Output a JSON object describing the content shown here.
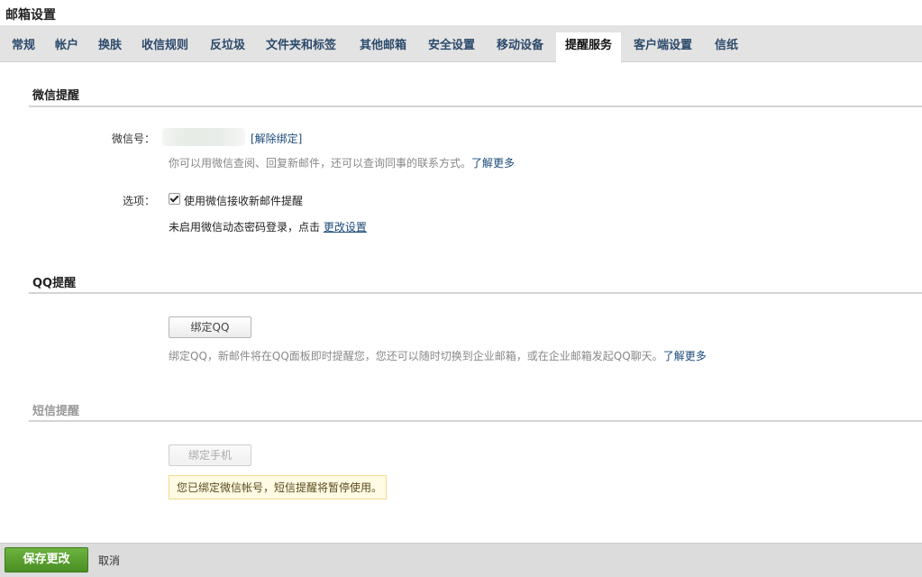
{
  "page_title": "邮箱设置",
  "tabs": [
    {
      "label": "常规"
    },
    {
      "label": "帐户"
    },
    {
      "label": "换肤"
    },
    {
      "label": "收信规则"
    },
    {
      "label": "反垃圾"
    },
    {
      "label": "文件夹和标签"
    },
    {
      "label": "其他邮箱"
    },
    {
      "label": "安全设置"
    },
    {
      "label": "移动设备"
    },
    {
      "label": "提醒服务",
      "active": true
    },
    {
      "label": "客户端设置"
    },
    {
      "label": "信纸"
    }
  ],
  "wechat": {
    "title": "微信提醒",
    "id_label": "微信号：",
    "unbind_link": "[解除绑定]",
    "hint": "你可以用微信查阅、回复新邮件，还可以查询同事的联系方式。",
    "learn_more": "了解更多",
    "options_label": "选项：",
    "checkbox_label": "使用微信接收新邮件提醒",
    "checkbox_checked": true,
    "dynamic_pwd_text": "未启用微信动态密码登录，点击",
    "change_settings_link": "更改设置"
  },
  "qq": {
    "title": "QQ提醒",
    "bind_button": "绑定QQ",
    "hint": "绑定QQ，新邮件将在QQ面板即时提醒您，您还可以随时切换到企业邮箱，或在企业邮箱发起QQ聊天。",
    "learn_more": "了解更多"
  },
  "sms": {
    "title": "短信提醒",
    "bind_button": "绑定手机",
    "notice": "您已绑定微信帐号，短信提醒将暂停使用。"
  },
  "footer": {
    "save_button": "保存更改",
    "cancel_link": "取消"
  }
}
